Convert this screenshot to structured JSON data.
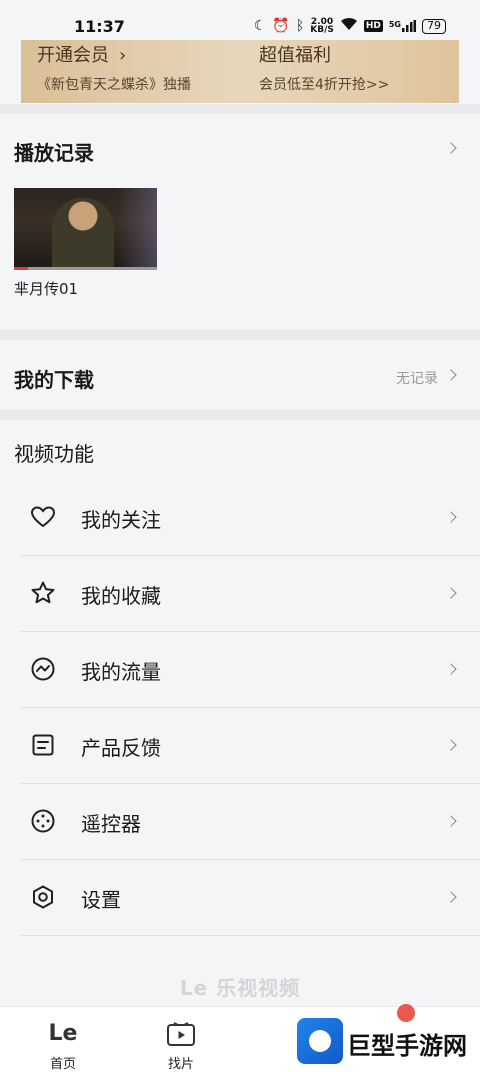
{
  "status": {
    "time": "11:37",
    "net_speed_top": "2.00",
    "net_speed_bottom": "KB/S",
    "hd": "HD",
    "signal": "5G",
    "battery": "79"
  },
  "vip_banner": {
    "left_title": "开通会员",
    "left_sub": "《新包青天之蝶杀》独播",
    "right_title": "超值福利",
    "right_sub": "会员低至4折开抢>>"
  },
  "history": {
    "title": "播放记录",
    "items": [
      {
        "label": "芈月传01",
        "progress": 0.1
      }
    ]
  },
  "downloads": {
    "title": "我的下载",
    "status": "无记录"
  },
  "video_functions": {
    "title": "视频功能",
    "items": [
      {
        "label": "我的关注",
        "icon": "heart-icon"
      },
      {
        "label": "我的收藏",
        "icon": "star-icon"
      },
      {
        "label": "我的流量",
        "icon": "traffic-icon"
      },
      {
        "label": "产品反馈",
        "icon": "feedback-icon"
      },
      {
        "label": "遥控器",
        "icon": "remote-icon"
      },
      {
        "label": "设置",
        "icon": "settings-icon"
      }
    ]
  },
  "watermark": "Le 乐视视频",
  "tabbar": {
    "tabs": [
      {
        "label": "首页",
        "icon": "le-logo-icon"
      },
      {
        "label": "找片",
        "icon": "film-icon"
      }
    ]
  },
  "brand": {
    "name": "巨型手游网"
  }
}
